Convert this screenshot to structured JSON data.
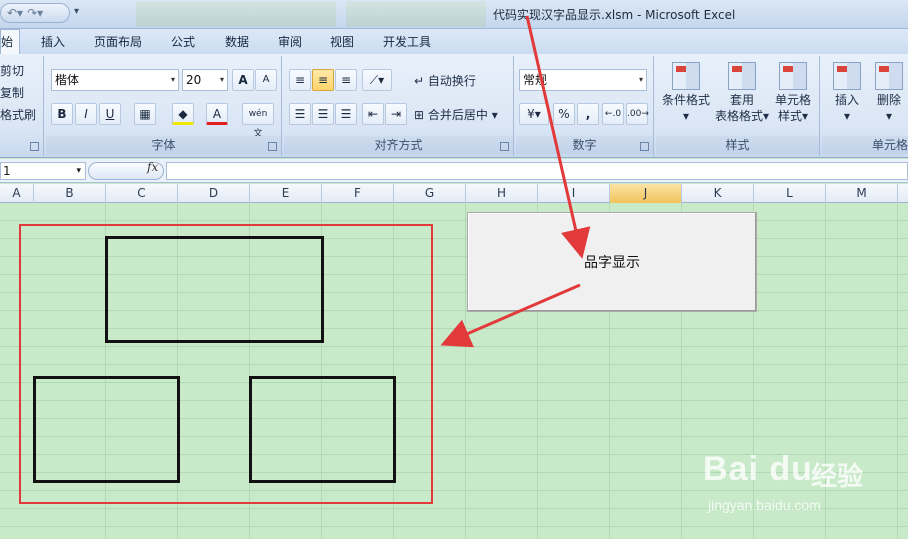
{
  "window": {
    "title": "代码实现汉字品显示.xlsm - Microsoft Excel"
  },
  "ribbon_tabs": [
    "始",
    "插入",
    "页面布局",
    "公式",
    "数据",
    "审阅",
    "视图",
    "开发工具"
  ],
  "clipboard": {
    "cut": "剪切",
    "copy": "复制",
    "format_painter": "格式刷"
  },
  "font_group": {
    "font_name": "楷体",
    "font_size": "20",
    "bold": "B",
    "italic": "I",
    "underline": "U",
    "label": "字体",
    "grow": "A",
    "shrink": "A",
    "phonetic": "wén 文",
    "font_color": "A"
  },
  "alignment_group": {
    "wrap_text": "自动换行",
    "merge_center": "合并后居中",
    "label": "对齐方式"
  },
  "number_group": {
    "format": "常规",
    "percent": "%",
    "comma": ",",
    "label": "数字"
  },
  "styles_group": {
    "conditional": "条件格式",
    "table_format_line1": "套用",
    "table_format_line2": "表格格式",
    "cell_styles_line1": "单元格",
    "cell_styles_line2": "样式",
    "label": "样式"
  },
  "cells_group": {
    "insert": "插入",
    "delete": "删除",
    "label": "单元格"
  },
  "formula_bar": {
    "name_box": "1",
    "fx": "fx"
  },
  "columns": [
    "A",
    "B",
    "C",
    "D",
    "E",
    "F",
    "G",
    "H",
    "I",
    "J",
    "K",
    "L",
    "M"
  ],
  "selected_column": "J",
  "sheet": {
    "button_label": "品字显示"
  },
  "colors": {
    "grid_background": "#c8eac9",
    "annotation_red": "#e23a3a"
  },
  "watermark": {
    "brand": "Bai du",
    "cn": "经验",
    "url": "jingyan.baidu.com"
  }
}
